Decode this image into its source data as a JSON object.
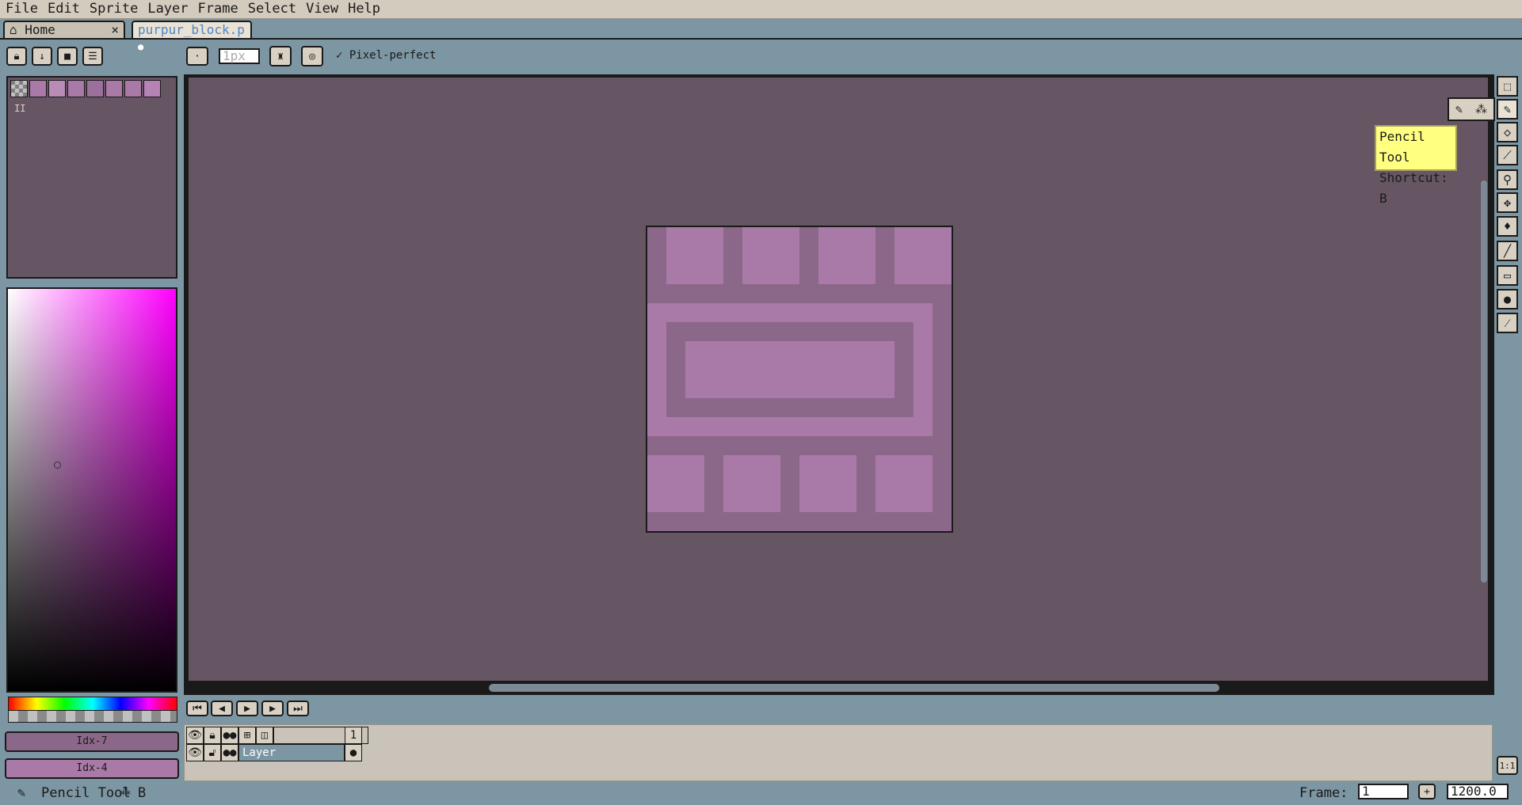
{
  "menubar": {
    "items": [
      "File",
      "Edit",
      "Sprite",
      "Layer",
      "Frame",
      "Select",
      "View",
      "Help"
    ]
  },
  "tabs": {
    "home_label": "Home",
    "file_label": "purpur_block.p",
    "close_glyph": "×",
    "modified_glyph": "●"
  },
  "toolbar": {
    "brush_size": "1px",
    "pixel_perfect_label": "Pixel-perfect",
    "pixel_perfect_checked": true
  },
  "palette": {
    "index_label": "II",
    "swatches": [
      "#a97aa8",
      "#b98cb8",
      "#a97aa8",
      "#9d6f9c",
      "#a97aa8",
      "#a97aa8",
      "#b683b5"
    ]
  },
  "colors": {
    "foreground_label": "Idx-7",
    "background_label": "Idx-4",
    "foreground_hex": "#8b6889",
    "background_hex": "#a97aa8"
  },
  "tooltip": {
    "line1": "Pencil Tool",
    "line2": "Shortcut: B"
  },
  "tools": [
    "marquee-icon",
    "pencil-icon",
    "eraser-icon",
    "eyedropper-icon",
    "zoom-icon",
    "move-icon",
    "bucket-icon",
    "line-icon",
    "rectangle-icon",
    "blur-icon",
    "spray-icon"
  ],
  "timeline": {
    "frame_number": "1",
    "layer_name": "Layer"
  },
  "statusbar": {
    "tool_label": "Pencil Tool",
    "shortcut": "B",
    "frame_label": "Frame:",
    "frame_value": "1",
    "zoom_value": "1200.0",
    "ratio_label": "1:1"
  }
}
